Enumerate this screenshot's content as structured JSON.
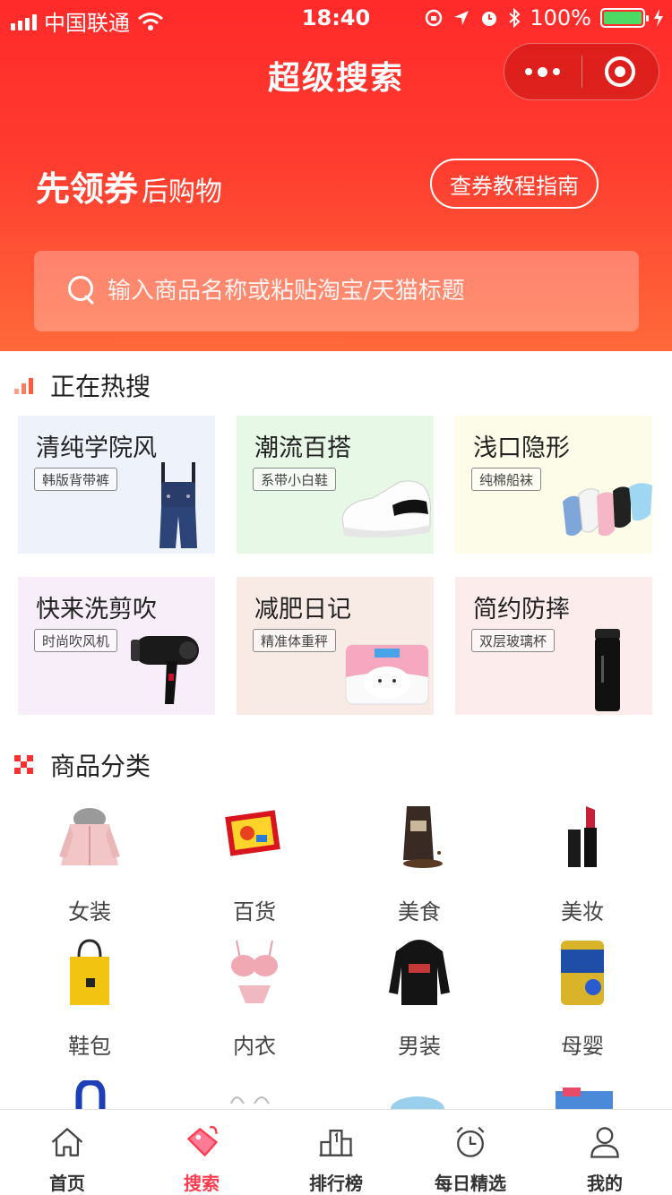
{
  "status_bar": {
    "carrier": "中国联通",
    "time": "18:40",
    "battery": "100%"
  },
  "nav": {
    "title": "超级搜索"
  },
  "banner": {
    "slogan_strong": "先领券",
    "slogan_light": "后购物",
    "guide_button": "查券教程指南"
  },
  "search": {
    "placeholder": "输入商品名称或粘贴淘宝/天猫标题"
  },
  "hot": {
    "heading": "正在热搜",
    "items": [
      {
        "title": "清纯学院风",
        "tag": "韩版背带裤",
        "bg": "#eef2fb"
      },
      {
        "title": "潮流百搭",
        "tag": "系带小白鞋",
        "bg": "#e8f8e6"
      },
      {
        "title": "浅口隐形",
        "tag": "纯棉船袜",
        "bg": "#fdfce8"
      },
      {
        "title": "快来洗剪吹",
        "tag": "时尚吹风机",
        "bg": "#f8eefa"
      },
      {
        "title": "减肥日记",
        "tag": "精准体重秤",
        "bg": "#f8ebe6"
      },
      {
        "title": "简约防摔",
        "tag": "双层玻璃杯",
        "bg": "#fcecec"
      }
    ]
  },
  "categories": {
    "heading": "商品分类",
    "items": [
      {
        "label": "女装",
        "icon": "coat-icon"
      },
      {
        "label": "百货",
        "icon": "warmer-pad-icon"
      },
      {
        "label": "美食",
        "icon": "coffee-bag-icon"
      },
      {
        "label": "美妆",
        "icon": "lipstick-icon"
      },
      {
        "label": "鞋包",
        "icon": "tote-bag-icon"
      },
      {
        "label": "内衣",
        "icon": "lingerie-icon"
      },
      {
        "label": "男装",
        "icon": "hoodie-icon"
      },
      {
        "label": "母婴",
        "icon": "formula-can-icon"
      }
    ]
  },
  "tabbar": {
    "items": [
      {
        "label": "首页"
      },
      {
        "label": "搜索"
      },
      {
        "label": "排行榜"
      },
      {
        "label": "每日精选"
      },
      {
        "label": "我的"
      }
    ]
  },
  "colors": {
    "brand": "#ff2a2a",
    "active_tab": "#ff3b4f"
  }
}
